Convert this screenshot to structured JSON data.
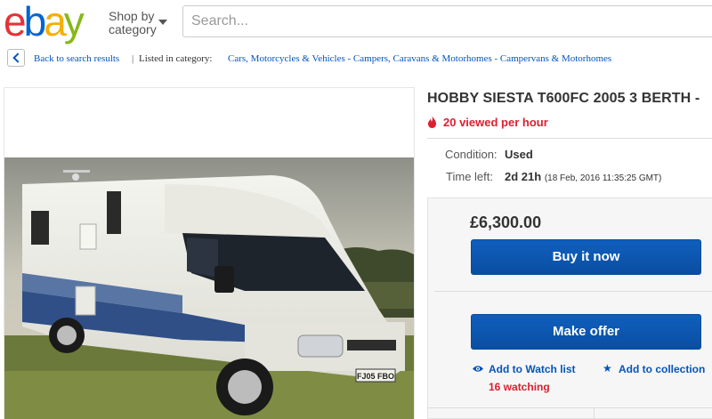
{
  "header": {
    "logo_letters": [
      {
        "ch": "e",
        "color": "#e53238"
      },
      {
        "ch": "b",
        "color": "#0064d2"
      },
      {
        "ch": "a",
        "color": "#f5af02"
      },
      {
        "ch": "y",
        "color": "#86b817"
      }
    ],
    "shop_by_line1": "Shop by",
    "shop_by_line2": "category",
    "search_placeholder": "Search..."
  },
  "breadcrumb": {
    "back_label": "Back to search results",
    "separator": "|",
    "listed_label": "Listed in category:",
    "category_path": "Cars, Motorcycles & Vehicles - Campers, Caravans & Motorhomes - Campervans & Motorhomes"
  },
  "listing": {
    "title": "HOBBY SIESTA T600FC 2005 3 BERTH -",
    "viewed": "20 viewed per hour",
    "condition_label": "Condition:",
    "condition_value": "Used",
    "time_left_label": "Time left:",
    "time_left_value": "2d 21h",
    "time_left_detail": "(18 Feb, 2016 11:35:25 GMT)",
    "price": "£6,300.00",
    "buy_now_label": "Buy it now",
    "make_offer_label": "Make offer",
    "watch_label": "Add to Watch list",
    "collection_label": "Add to collection",
    "watching": "16 watching",
    "plate": "FJ05 FBO"
  },
  "colors": {
    "accent_blue": "#0654ba",
    "button_blue": "#0f5fbd",
    "alert_red": "#dd1e31"
  },
  "icons": {
    "back": "chevron-left-icon",
    "viewed": "fire-icon",
    "watch": "eye-icon",
    "collection": "star-icon",
    "category": "caret-down-icon"
  }
}
